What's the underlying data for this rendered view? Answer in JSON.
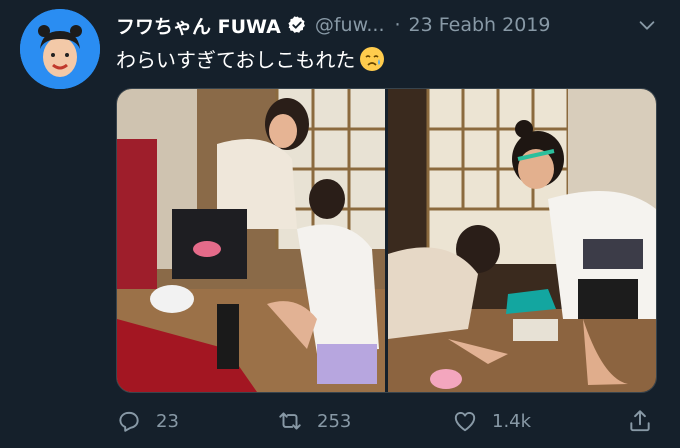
{
  "tweet": {
    "display_name": "フワちゃん FUWA",
    "handle": "@fuw...",
    "separator": "·",
    "date": "23 Feabh 2019",
    "text": "わらいすぎておしこもれた"
  },
  "icons": {
    "verified": "verified-badge-icon",
    "caret": "chevron-down-icon",
    "emoji": "crying-face-emoji",
    "reply": "reply-icon",
    "retweet": "retweet-icon",
    "like": "heart-icon",
    "share": "share-icon"
  },
  "stats": {
    "replies": "23",
    "retweets": "253",
    "likes": "1.4k"
  },
  "colors": {
    "background": "#15202b",
    "secondary_text": "#8899a6",
    "avatar_bg": "#2a8df2"
  }
}
